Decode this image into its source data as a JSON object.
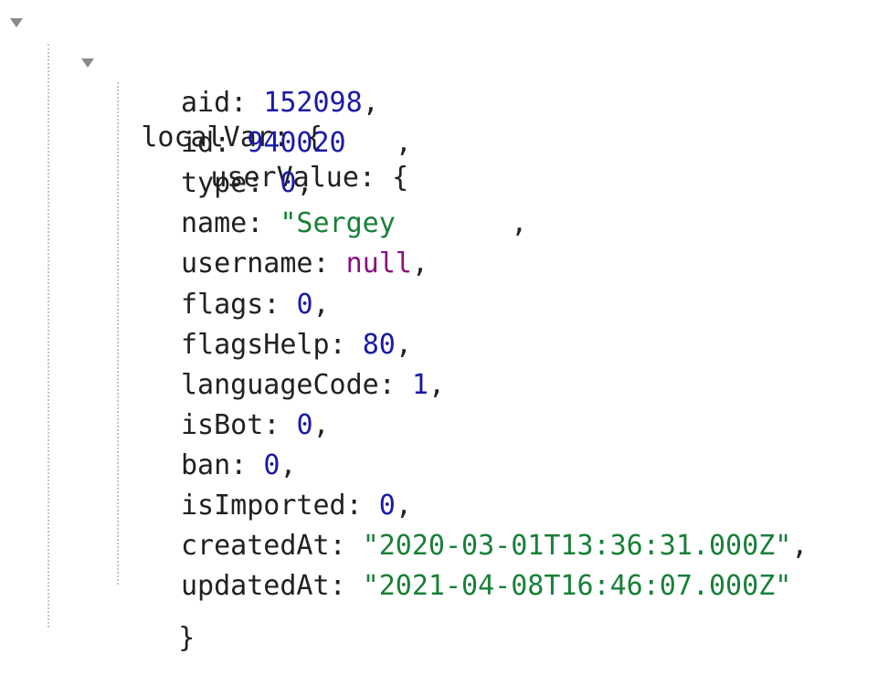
{
  "root": {
    "key": "localVar",
    "open_brace": "{",
    "toggle_icon": "triangle-down-icon"
  },
  "user_value": {
    "key": "userValue",
    "open_brace": "{",
    "close_brace": "}",
    "toggle_icon": "triangle-down-icon"
  },
  "colors": {
    "number": "#1a1aa6",
    "string": "#188038",
    "null": "#881280",
    "key": "#202124",
    "guide": "#c4c4c4"
  },
  "properties": [
    {
      "key": "aid",
      "value": "152098",
      "type": "number",
      "trailing": ","
    },
    {
      "key": "id",
      "value": "940020",
      "type": "number",
      "trailing": "   ,"
    },
    {
      "key": "type",
      "value": "0",
      "type": "number",
      "trailing": ","
    },
    {
      "key": "name",
      "value": "\"Sergey",
      "type": "string",
      "trailing": "       ,"
    },
    {
      "key": "username",
      "value": "null",
      "type": "null",
      "trailing": ","
    },
    {
      "key": "flags",
      "value": "0",
      "type": "number",
      "trailing": ","
    },
    {
      "key": "flagsHelp",
      "value": "80",
      "type": "number",
      "trailing": ","
    },
    {
      "key": "languageCode",
      "value": "1",
      "type": "number",
      "trailing": ","
    },
    {
      "key": "isBot",
      "value": "0",
      "type": "number",
      "trailing": ","
    },
    {
      "key": "ban",
      "value": "0",
      "type": "number",
      "trailing": ","
    },
    {
      "key": "isImported",
      "value": "0",
      "type": "number",
      "trailing": ","
    },
    {
      "key": "createdAt",
      "value": "\"2020-03-01T13:36:31.000Z\"",
      "type": "string",
      "trailing": ","
    },
    {
      "key": "updatedAt",
      "value": "\"2021-04-08T16:46:07.000Z\"",
      "type": "string",
      "trailing": ""
    }
  ]
}
